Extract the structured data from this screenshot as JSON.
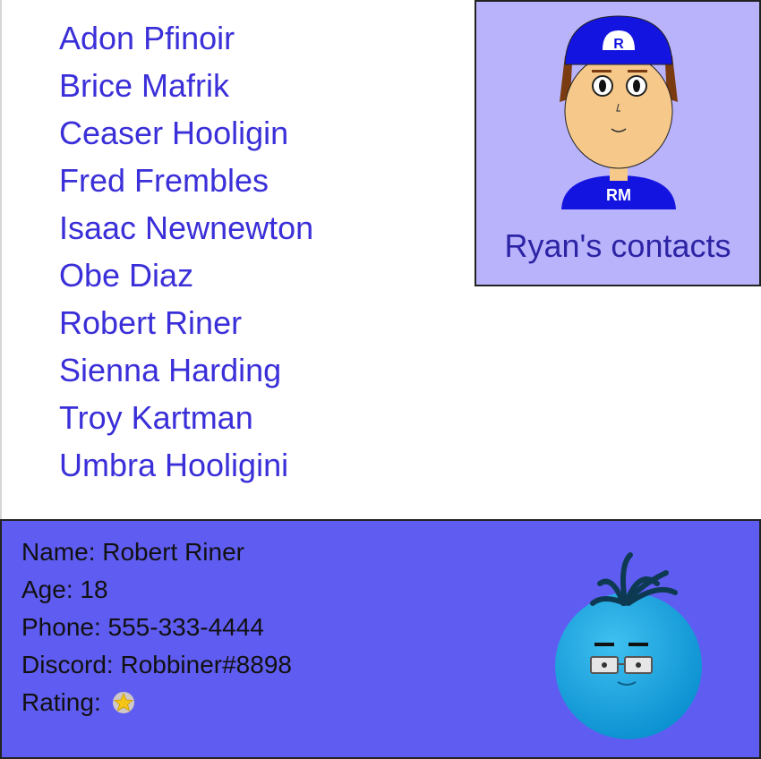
{
  "contacts": [
    "Adon Pfinoir",
    "Brice Mafrik",
    "Ceaser Hooligin",
    "Fred Frembles",
    "Isaac Newnewton",
    "Obe Diaz",
    "Robert Riner",
    "Sienna Harding",
    "Troy Kartman",
    "Umbra Hooligini"
  ],
  "owner": {
    "caption": "Ryan's contacts",
    "cap_letter": "R",
    "shirt_initials": "RM"
  },
  "selected": {
    "name_label": "Name:",
    "name": "Robert Riner",
    "age_label": "Age:",
    "age": "18",
    "phone_label": "Phone:",
    "phone": "555-333-4444",
    "discord_label": "Discord:",
    "discord": "Robbiner#8898",
    "rating_label": "Rating:",
    "rating_stars": 1
  },
  "colors": {
    "link": "#3a2fd8",
    "owner_card_bg": "#b9b3fb",
    "details_bg": "#5f5cf1",
    "star": "#f5c518"
  },
  "icons": {
    "owner_avatar": "cartoon-boy-cap-avatar",
    "contact_avatar": "blue-ball-glasses-avatar",
    "rating": "star-icon"
  }
}
